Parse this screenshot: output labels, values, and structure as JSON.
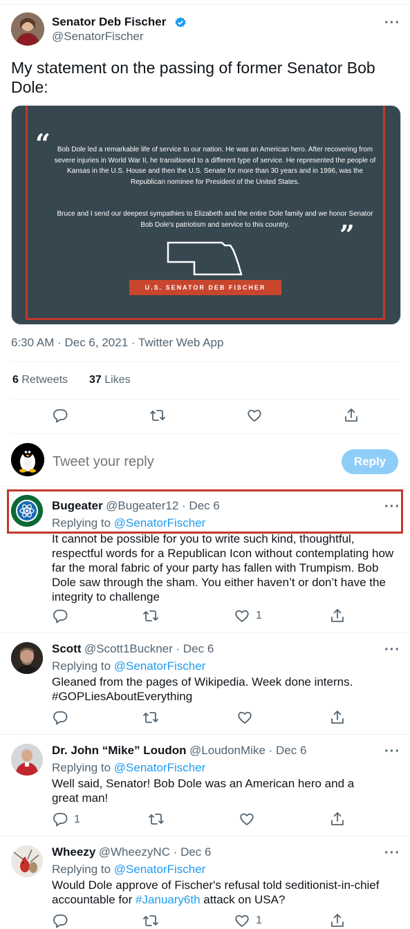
{
  "main_tweet": {
    "author_name": "Senator Deb Fischer",
    "author_handle": "@SenatorFischer",
    "text": "My statement on the passing of former Senator Bob Dole:",
    "image": {
      "paragraph1": "Bob Dole led a remarkable life of service to our nation. He was an American hero. After recovering from severe injuries in World War II, he transitioned to a different type of service. He represented the people of Kansas in the U.S. House and then the U.S. Senate for more than 30 years and in 1996, was the Republican nominee for President of the United States.",
      "paragraph2": "Bruce and I send our deepest sympathies to Elizabeth and the entire Dole family and we honor Senator Bob Dole's patriotism and service to this country.",
      "banner": "U.S. SENATOR DEB FISCHER"
    },
    "timestamp": "6:30 AM · Dec 6, 2021 · Twitter Web App",
    "retweets_count": "6",
    "retweets_label": "Retweets",
    "likes_count": "37",
    "likes_label": "Likes"
  },
  "composer": {
    "placeholder": "Tweet your reply",
    "button_label": "Reply"
  },
  "replies": [
    {
      "name": "Bugeater",
      "handle": "@Bugeater12 · Dec 6",
      "replying_prefix": "Replying to",
      "replying_to": "@SenatorFischer",
      "text": "It cannot be possible for you to write such kind, thoughtful, respectful words for a Republican Icon without contemplating how far the moral fabric of your party has fallen with Trumpism. Bob Dole saw through the sham. You either haven’t or don’t have the integrity to challenge",
      "reply_count": "",
      "like_count": "1"
    },
    {
      "name": "Scott",
      "handle": "@Scott1Buckner · Dec 6",
      "replying_prefix": "Replying to",
      "replying_to": "@SenatorFischer",
      "text": "Gleaned from the pages of Wikipedia. Week done interns.",
      "hashtag": "#GOPLiesAboutEverything",
      "reply_count": "",
      "like_count": ""
    },
    {
      "name": "Dr. John “Mike” Loudon",
      "handle": "@LoudonMike · Dec 6",
      "replying_prefix": "Replying to",
      "replying_to": "@SenatorFischer",
      "text": "Well said, Senator! Bob Dole was an American hero and a great man!",
      "reply_count": "1",
      "like_count": ""
    },
    {
      "name": "Wheezy",
      "handle": "@WheezyNC · Dec 6",
      "replying_prefix": "Replying to",
      "replying_to": "@SenatorFischer",
      "text_before": "Would Dole approve of Fischer's refusal told seditionist-in-chief accountable for",
      "hashtag": "#January6th",
      "text_after": "attack on USA?",
      "reply_count": "",
      "like_count": "1"
    }
  ],
  "colors": {
    "accent": "#1d9bf0",
    "reply_button_disabled": "#8ecdf8",
    "image_background": "#37474f",
    "image_border": "#c0392b",
    "highlight_box": "#c0392b"
  }
}
